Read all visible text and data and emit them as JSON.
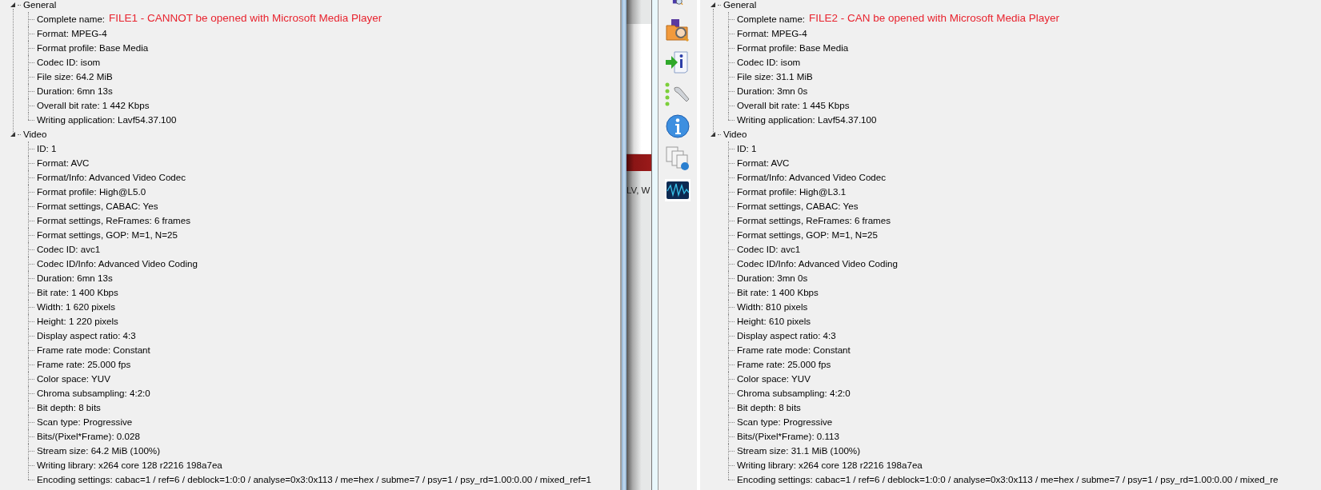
{
  "panels": [
    {
      "sections": [
        {
          "title": "General",
          "expanded": true,
          "items": [
            {
              "text": "Complete name:",
              "note": "FILE1 - CANNOT be opened with Microsoft Media Player"
            },
            {
              "text": "Format: MPEG-4"
            },
            {
              "text": "Format profile: Base Media"
            },
            {
              "text": "Codec ID: isom"
            },
            {
              "text": "File size: 64.2 MiB"
            },
            {
              "text": "Duration: 6mn 13s"
            },
            {
              "text": "Overall bit rate: 1 442 Kbps"
            },
            {
              "text": "Writing application: Lavf54.37.100"
            }
          ]
        },
        {
          "title": "Video",
          "expanded": true,
          "items": [
            {
              "text": "ID: 1"
            },
            {
              "text": "Format: AVC"
            },
            {
              "text": "Format/Info: Advanced Video Codec"
            },
            {
              "text": "Format profile: High@L5.0"
            },
            {
              "text": "Format settings, CABAC: Yes"
            },
            {
              "text": "Format settings, ReFrames: 6 frames"
            },
            {
              "text": "Format settings, GOP: M=1, N=25"
            },
            {
              "text": "Codec ID: avc1"
            },
            {
              "text": "Codec ID/Info: Advanced Video Coding"
            },
            {
              "text": "Duration: 6mn 13s"
            },
            {
              "text": "Bit rate: 1 400 Kbps"
            },
            {
              "text": "Width: 1 620 pixels"
            },
            {
              "text": "Height: 1 220 pixels"
            },
            {
              "text": "Display aspect ratio: 4:3"
            },
            {
              "text": "Frame rate mode: Constant"
            },
            {
              "text": "Frame rate: 25.000 fps"
            },
            {
              "text": "Color space: YUV"
            },
            {
              "text": "Chroma subsampling: 4:2:0"
            },
            {
              "text": "Bit depth: 8 bits"
            },
            {
              "text": "Scan type: Progressive"
            },
            {
              "text": "Bits/(Pixel*Frame): 0.028"
            },
            {
              "text": "Stream size: 64.2 MiB (100%)"
            },
            {
              "text": "Writing library: x264 core 128 r2216 198a7ea"
            },
            {
              "text": "Encoding settings: cabac=1 / ref=6 / deblock=1:0:0 / analyse=0x3:0x113 / me=hex / subme=7 / psy=1 / psy_rd=1.00:0.00 / mixed_ref=1"
            }
          ]
        }
      ]
    },
    {
      "sections": [
        {
          "title": "General",
          "expanded": true,
          "items": [
            {
              "text": "Complete name:",
              "note": "FILE2 - CAN be opened with Microsoft Media Player"
            },
            {
              "text": "Format: MPEG-4"
            },
            {
              "text": "Format profile: Base Media"
            },
            {
              "text": "Codec ID: isom"
            },
            {
              "text": "File size: 31.1 MiB"
            },
            {
              "text": "Duration: 3mn 0s"
            },
            {
              "text": "Overall bit rate: 1 445 Kbps"
            },
            {
              "text": "Writing application: Lavf54.37.100"
            }
          ]
        },
        {
          "title": "Video",
          "expanded": true,
          "items": [
            {
              "text": "ID: 1"
            },
            {
              "text": "Format: AVC"
            },
            {
              "text": "Format/Info: Advanced Video Codec"
            },
            {
              "text": "Format profile: High@L3.1"
            },
            {
              "text": "Format settings, CABAC: Yes"
            },
            {
              "text": "Format settings, ReFrames: 6 frames"
            },
            {
              "text": "Format settings, GOP: M=1, N=25"
            },
            {
              "text": "Codec ID: avc1"
            },
            {
              "text": "Codec ID/Info: Advanced Video Coding"
            },
            {
              "text": "Duration: 3mn 0s"
            },
            {
              "text": "Bit rate: 1 400 Kbps"
            },
            {
              "text": "Width: 810 pixels"
            },
            {
              "text": "Height: 610 pixels"
            },
            {
              "text": "Display aspect ratio: 4:3"
            },
            {
              "text": "Frame rate mode: Constant"
            },
            {
              "text": "Frame rate: 25.000 fps"
            },
            {
              "text": "Color space: YUV"
            },
            {
              "text": "Chroma subsampling: 4:2:0"
            },
            {
              "text": "Bit depth: 8 bits"
            },
            {
              "text": "Scan type: Progressive"
            },
            {
              "text": "Bits/(Pixel*Frame): 0.113"
            },
            {
              "text": "Stream size: 31.1 MiB (100%)"
            },
            {
              "text": "Writing library: x264 core 128 r2216 198a7ea"
            },
            {
              "text": "Encoding settings: cabac=1 / ref=6 / deblock=1:0:0 / analyse=0x3:0x113 / me=hex / subme=7 / psy=1 / psy_rd=1.00:0.00 / mixed_re"
            }
          ]
        }
      ]
    }
  ],
  "background_window": {
    "text": "LV, W"
  }
}
